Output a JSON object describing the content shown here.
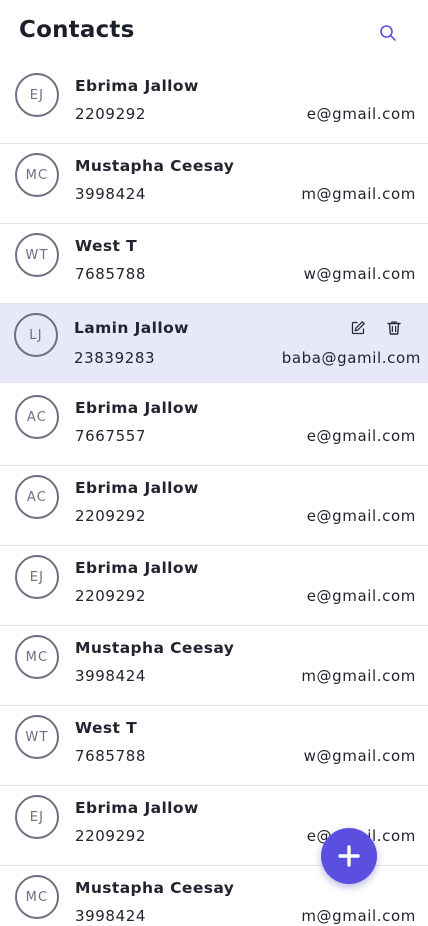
{
  "header": {
    "title": "Contacts"
  },
  "colors": {
    "accent": "#5b4fe0",
    "selected_row": "#e7e8f8",
    "avatar_border": "#6b7182"
  },
  "contacts": [
    {
      "initials": "EJ",
      "name": "Ebrima Jallow",
      "phone": "2209292",
      "email": "e@gmail.com"
    },
    {
      "initials": "MC",
      "name": "Mustapha Ceesay",
      "phone": "3998424",
      "email": "m@gmail.com"
    },
    {
      "initials": "WT",
      "name": "West T",
      "phone": "7685788",
      "email": "w@gmail.com"
    },
    {
      "initials": "LJ",
      "name": "Lamin Jallow",
      "phone": "23839283",
      "email": "baba@gamil.com",
      "selected": true
    },
    {
      "initials": "AC",
      "name": "Ebrima Jallow",
      "phone": "7667557",
      "email": "e@gmail.com"
    },
    {
      "initials": "AC",
      "name": "Ebrima Jallow",
      "phone": "2209292",
      "email": "e@gmail.com"
    },
    {
      "initials": "EJ",
      "name": "Ebrima Jallow",
      "phone": "2209292",
      "email": "e@gmail.com"
    },
    {
      "initials": "MC",
      "name": "Mustapha Ceesay",
      "phone": "3998424",
      "email": "m@gmail.com"
    },
    {
      "initials": "WT",
      "name": "West T",
      "phone": "7685788",
      "email": "w@gmail.com"
    },
    {
      "initials": "EJ",
      "name": "Ebrima Jallow",
      "phone": "2209292",
      "email": "e@gmail.com"
    },
    {
      "initials": "MC",
      "name": "Mustapha Ceesay",
      "phone": "3998424",
      "email": "m@gmail.com"
    }
  ],
  "icons": {
    "search": "search-icon",
    "edit": "edit-icon",
    "delete": "trash-icon",
    "add": "plus-icon"
  }
}
